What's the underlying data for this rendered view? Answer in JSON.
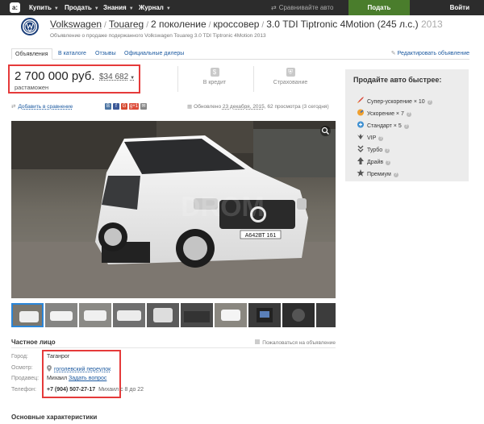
{
  "topbar": {
    "logo": "a:",
    "nav": [
      {
        "label": "Купить"
      },
      {
        "label": "Продать"
      },
      {
        "label": "Знания"
      },
      {
        "label": "Журнал"
      }
    ],
    "compare": "Сравнивайте авто",
    "sell_button": "Подать объявление",
    "login": "Войти"
  },
  "header": {
    "brand": "Volkswagen",
    "model": "Touareg",
    "generation": "2 поколение",
    "body": "кроссовер",
    "trim": "3.0 TDI Tiptronic 4Motion (245 л.с.)",
    "year": "2013",
    "subtitle": "Объявление о продаже подержанного Volkswagen Touareg 3.0 TDI Tiptronic 4Motion 2013"
  },
  "tabs": [
    "Объявления",
    "В каталоге",
    "Отзывы",
    "Официальные дилеры"
  ],
  "edit_ad": "Редактировать объявление",
  "price": {
    "rub": "2 700 000 руб.",
    "usd": "$34 682",
    "status": "растаможен"
  },
  "features": [
    {
      "icon": "credit-icon",
      "label": "В кредит"
    },
    {
      "icon": "insurance-icon",
      "label": "Страхование"
    }
  ],
  "actions": {
    "add_compare": "Добавить в сравнение",
    "updated_prefix": "Обновлено",
    "updated_date": "23 декабря, 2015",
    "views": "62 просмотра (3 сегодня)"
  },
  "social": [
    "В",
    "f",
    "G",
    "g+1",
    "✉"
  ],
  "seller": {
    "title": "Частное лицо",
    "complain": "Пожаловаться на объявление",
    "rows": [
      {
        "label": "Город:",
        "value": "Таганрог"
      },
      {
        "label": "Осмотр:",
        "value": "гоголевский переулок"
      },
      {
        "label": "Продавец:",
        "value": "Михаил",
        "link": "Задать вопрос"
      },
      {
        "label": "Телефон:",
        "value": "+7 (904) 507-27-17",
        "extra": "Михаил с 8 до 22"
      }
    ]
  },
  "main_chars": "Основные характеристики",
  "sidebar": {
    "title": "Продайте авто быстрее:",
    "items": [
      {
        "label": "Супер-ускорение × 10",
        "icon": "rocket-icon"
      },
      {
        "label": "Ускорение × 7",
        "icon": "speed-icon"
      },
      {
        "label": "Стандарт × 5",
        "icon": "standard-icon"
      },
      {
        "label": "VIP",
        "icon": "vip-icon"
      },
      {
        "label": "Турбо",
        "icon": "turbo-icon"
      },
      {
        "label": "Драйв",
        "icon": "drive-icon"
      },
      {
        "label": "Премиум",
        "icon": "premium-icon"
      }
    ]
  },
  "photo": {
    "plate": "А642ВТ 161"
  },
  "colors": {
    "topbar": "#2c2c2c",
    "sell": "#4a7d2c",
    "link": "#1d5aa0",
    "highlight": "#e53a3a",
    "sidebar": "#ececec"
  }
}
